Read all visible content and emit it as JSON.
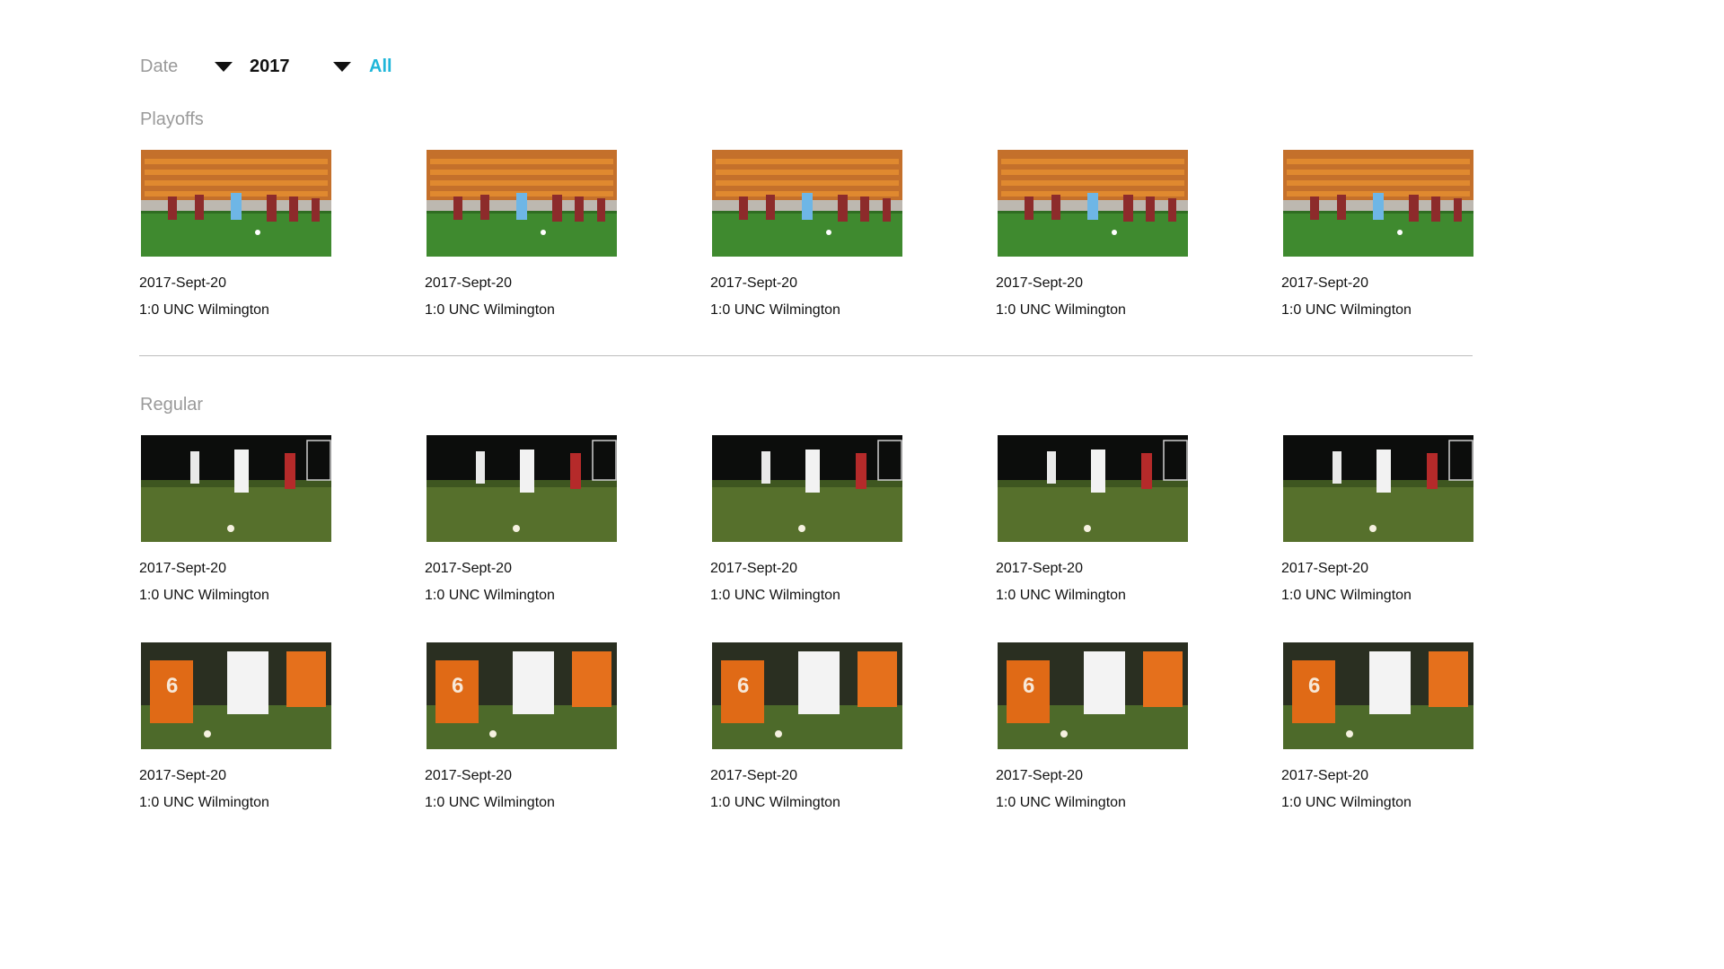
{
  "filters": {
    "date_label": "Date",
    "year_value": "2017",
    "all_label": "All"
  },
  "sections": {
    "playoffs_title": "Playoffs",
    "regular_title": "Regular"
  },
  "games": {
    "playoffs": [
      {
        "date": "2017-Sept-20",
        "match": "1:0 UNC Wilmington"
      },
      {
        "date": "2017-Sept-20",
        "match": "1:0 UNC Wilmington"
      },
      {
        "date": "2017-Sept-20",
        "match": "1:0 UNC Wilmington"
      },
      {
        "date": "2017-Sept-20",
        "match": "1:0 UNC Wilmington"
      },
      {
        "date": "2017-Sept-20",
        "match": "1:0 UNC Wilmington"
      }
    ],
    "regular_row1": [
      {
        "date": "2017-Sept-20",
        "match": "1:0 UNC Wilmington"
      },
      {
        "date": "2017-Sept-20",
        "match": "1:0 UNC Wilmington"
      },
      {
        "date": "2017-Sept-20",
        "match": "1:0 UNC Wilmington"
      },
      {
        "date": "2017-Sept-20",
        "match": "1:0 UNC Wilmington"
      },
      {
        "date": "2017-Sept-20",
        "match": "1:0 UNC Wilmington"
      }
    ],
    "regular_row2": [
      {
        "date": "2017-Sept-20",
        "match": "1:0 UNC Wilmington"
      },
      {
        "date": "2017-Sept-20",
        "match": "1:0 UNC Wilmington"
      },
      {
        "date": "2017-Sept-20",
        "match": "1:0 UNC Wilmington"
      },
      {
        "date": "2017-Sept-20",
        "match": "1:0 UNC Wilmington"
      },
      {
        "date": "2017-Sept-20",
        "match": "1:0 UNC Wilmington"
      }
    ]
  },
  "icons": {
    "date_dropdown": "caret-down-icon",
    "year_dropdown": "caret-down-icon"
  },
  "colors": {
    "accent": "#1fb6d9",
    "muted_text": "#9a9a9a",
    "divider": "#bdbdbd"
  }
}
